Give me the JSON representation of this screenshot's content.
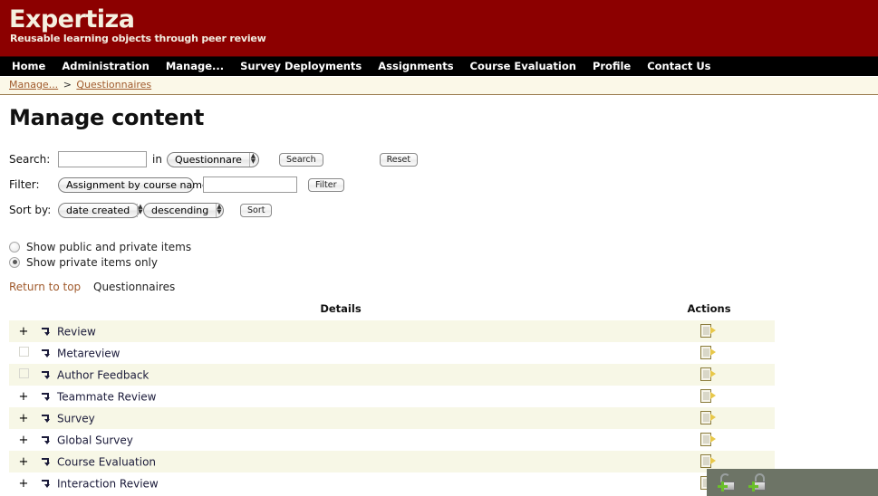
{
  "masthead": {
    "title": "Expertiza",
    "tagline": "Reusable learning objects through peer review"
  },
  "nav": {
    "items": [
      {
        "label": "Home",
        "name": "nav-home"
      },
      {
        "label": "Administration",
        "name": "nav-administration"
      },
      {
        "label": "Manage...",
        "name": "nav-manage"
      },
      {
        "label": "Survey Deployments",
        "name": "nav-survey-deployments"
      },
      {
        "label": "Assignments",
        "name": "nav-assignments"
      },
      {
        "label": "Course Evaluation",
        "name": "nav-course-evaluation"
      },
      {
        "label": "Profile",
        "name": "nav-profile"
      },
      {
        "label": "Contact Us",
        "name": "nav-contact-us"
      }
    ]
  },
  "breadcrumb": {
    "first": "Manage...",
    "separator": ">",
    "second": "Questionnaires"
  },
  "page": {
    "title": "Manage content"
  },
  "controls": {
    "search": {
      "label": "Search:",
      "input_value": "",
      "input_placeholder": "",
      "in_word": "in",
      "scope_select": "Questionnare",
      "search_button": "Search",
      "reset_button": "Reset"
    },
    "filter": {
      "label": "Filter:",
      "criteria_select": "Assignment by course name",
      "input_value": "",
      "input_placeholder": "",
      "filter_button": "Filter"
    },
    "sort": {
      "label": "Sort by:",
      "field_select": "date created",
      "direction_select": "descending",
      "sort_button": "Sort"
    }
  },
  "visibility": {
    "options": [
      {
        "label": "Show public and private items",
        "checked": false,
        "name": "radio-show-public-and-private"
      },
      {
        "label": "Show private items only",
        "checked": true,
        "name": "radio-show-private-only"
      }
    ]
  },
  "links_row": {
    "return_to_top": "Return to top",
    "section": "Questionnaires"
  },
  "table": {
    "headers": {
      "toggle": "",
      "details": "Details",
      "actions": "Actions"
    },
    "rows": [
      {
        "toggle": "+",
        "expandable": true,
        "name": "Review",
        "action_icon": "document-edit-icon"
      },
      {
        "toggle": "",
        "expandable": false,
        "name": "Metareview",
        "action_icon": "document-edit-icon"
      },
      {
        "toggle": "",
        "expandable": false,
        "name": "Author Feedback",
        "action_icon": "document-edit-icon"
      },
      {
        "toggle": "+",
        "expandable": true,
        "name": "Teammate Review",
        "action_icon": "document-edit-icon"
      },
      {
        "toggle": "+",
        "expandable": true,
        "name": "Survey",
        "action_icon": "document-edit-icon"
      },
      {
        "toggle": "+",
        "expandable": true,
        "name": "Global Survey",
        "action_icon": "document-edit-icon"
      },
      {
        "toggle": "+",
        "expandable": true,
        "name": "Course Evaluation",
        "action_icon": "document-edit-icon"
      },
      {
        "toggle": "+",
        "expandable": true,
        "name": "Interaction Review",
        "action_icon": "document-edit-icon"
      }
    ]
  },
  "lock_overlay": {
    "icons": [
      {
        "name": "add-unlock-icon",
        "state": "open"
      },
      {
        "name": "add-lock-icon",
        "state": "closed"
      }
    ],
    "background": "#6d7466"
  },
  "colors": {
    "masthead": "#8c0000",
    "navbar": "#000000",
    "breadcrumb_bg": "#fbf8e8",
    "link": "#a05a2c",
    "row_stripe": "#f7f7e6"
  }
}
